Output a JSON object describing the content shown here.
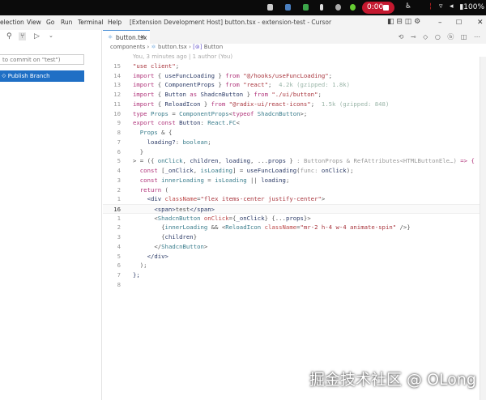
{
  "system_bar": {
    "recording_time": "0:00",
    "battery": "100%"
  },
  "menu": [
    "election",
    "View",
    "Go",
    "Run",
    "Terminal",
    "Help"
  ],
  "window_title": "[Extension Development Host] button.tsx - extension-test - Cursor",
  "sidebar": {
    "commit_placeholder": "to commit on \"test\")",
    "publish_label": "Publish Branch"
  },
  "tab": {
    "label": "button.tsx"
  },
  "breadcrumb": {
    "folder": "components",
    "file": "button.tsx",
    "symbol": "Button"
  },
  "blame": "You, 3 minutes ago | 1 author (You)",
  "code": [
    {
      "n": "15",
      "t": [
        [
          "\"use client\"",
          "s"
        ],
        [
          ";",
          "p"
        ]
      ]
    },
    {
      "n": "14",
      "t": [
        [
          "import",
          "k"
        ],
        [
          " { ",
          "p"
        ],
        [
          "useFuncLoading",
          "i"
        ],
        [
          " } ",
          "p"
        ],
        [
          "from",
          "k"
        ],
        [
          " \"@/hooks/useFuncLoading\"",
          "s"
        ],
        [
          ";",
          "p"
        ]
      ]
    },
    {
      "n": "13",
      "t": [
        [
          "import",
          "k"
        ],
        [
          " { ",
          "p"
        ],
        [
          "ComponentProps",
          "i"
        ],
        [
          " } ",
          "p"
        ],
        [
          "from",
          "k"
        ],
        [
          " \"react\"",
          "s"
        ],
        [
          ";  ",
          "p"
        ],
        [
          "4.2k (gzipped: 1.8k)",
          "h"
        ]
      ]
    },
    {
      "n": "12",
      "t": [
        [
          "import",
          "k"
        ],
        [
          " { ",
          "p"
        ],
        [
          "Button",
          "i"
        ],
        [
          " as ",
          "k"
        ],
        [
          "ShadcnButton",
          "i"
        ],
        [
          " } ",
          "p"
        ],
        [
          "from",
          "k"
        ],
        [
          " \"./ui/button\"",
          "s"
        ],
        [
          ";",
          "p"
        ]
      ]
    },
    {
      "n": "11",
      "t": [
        [
          "import",
          "k"
        ],
        [
          " { ",
          "p"
        ],
        [
          "ReloadIcon",
          "i"
        ],
        [
          " } ",
          "p"
        ],
        [
          "from",
          "k"
        ],
        [
          " \"@radix-ui/react-icons\"",
          "s"
        ],
        [
          ";  ",
          "p"
        ],
        [
          "1.5k (gzipped: 848)",
          "h"
        ]
      ]
    },
    {
      "n": "10",
      "t": [
        [
          "type",
          "k"
        ],
        [
          " Props",
          "t"
        ],
        [
          " = ",
          "p"
        ],
        [
          "ComponentProps",
          "t"
        ],
        [
          "<",
          "p"
        ],
        [
          "typeof",
          "k"
        ],
        [
          " ShadcnButton",
          "t"
        ],
        [
          ">;",
          "p"
        ]
      ]
    },
    {
      "n": "9",
      "t": [
        [
          "export const",
          "k"
        ],
        [
          " Button",
          "i"
        ],
        [
          ": ",
          "p"
        ],
        [
          "React",
          "t"
        ],
        [
          ".",
          "p"
        ],
        [
          "FC",
          "t"
        ],
        [
          "<",
          "p"
        ]
      ]
    },
    {
      "n": "8",
      "t": [
        [
          "  Props",
          "t"
        ],
        [
          " & {",
          "p"
        ]
      ]
    },
    {
      "n": "7",
      "t": [
        [
          "    loading?",
          "i"
        ],
        [
          ": ",
          "p"
        ],
        [
          "boolean",
          "t"
        ],
        [
          ";",
          "p"
        ]
      ]
    },
    {
      "n": "6",
      "t": [
        [
          "  }",
          "p"
        ]
      ]
    },
    {
      "n": "5",
      "t": [
        [
          "> = ({ ",
          "p"
        ],
        [
          "onClick",
          "t"
        ],
        [
          ", ",
          "p"
        ],
        [
          "children",
          "i"
        ],
        [
          ", ",
          "p"
        ],
        [
          "loading",
          "i"
        ],
        [
          ", ...",
          "p"
        ],
        [
          "props",
          "i"
        ],
        [
          " } ",
          "p"
        ],
        [
          ": ButtonProps & RefAttributes<HTMLButtonEle…)",
          "g"
        ],
        [
          " => {",
          "k"
        ]
      ]
    },
    {
      "n": "4",
      "t": [
        [
          "  const",
          "k"
        ],
        [
          " [",
          "p"
        ],
        [
          "_onClick",
          "i"
        ],
        [
          ", ",
          "p"
        ],
        [
          "isLoading",
          "t"
        ],
        [
          "] = ",
          "p"
        ],
        [
          "useFuncLoading",
          "i"
        ],
        [
          "(",
          "p"
        ],
        [
          "func:",
          "g"
        ],
        [
          " onClick",
          "i"
        ],
        [
          ");",
          "p"
        ]
      ]
    },
    {
      "n": "3",
      "t": [
        [
          "  const",
          "k"
        ],
        [
          " innerLoading",
          "t"
        ],
        [
          " = ",
          "p"
        ],
        [
          "isLoading",
          "t"
        ],
        [
          " || ",
          "p"
        ],
        [
          "loading",
          "i"
        ],
        [
          ";",
          "p"
        ]
      ]
    },
    {
      "n": "2",
      "t": [
        [
          "  return",
          "k"
        ],
        [
          " (",
          "p"
        ]
      ]
    },
    {
      "n": "1",
      "t": [
        [
          "    <div ",
          "i"
        ],
        [
          "className",
          "a"
        ],
        [
          "=",
          "p"
        ],
        [
          "\"flex items-center justify-center\"",
          "s"
        ],
        [
          ">",
          "p"
        ]
      ]
    },
    {
      "n": "16",
      "cur": true,
      "t": [
        [
          "      <span>",
          "i"
        ],
        [
          "test",
          "p"
        ],
        [
          "</span>",
          "i"
        ]
      ]
    },
    {
      "n": "1",
      "t": [
        [
          "      <",
          "p"
        ],
        [
          "ShadcnButton",
          "t"
        ],
        [
          " onClick",
          "a"
        ],
        [
          "={",
          "p"
        ],
        [
          "_onClick",
          "i"
        ],
        [
          "} {...",
          "p"
        ],
        [
          "props",
          "i"
        ],
        [
          "}>",
          "p"
        ]
      ]
    },
    {
      "n": "2",
      "t": [
        [
          "        {",
          "p"
        ],
        [
          "innerLoading",
          "t"
        ],
        [
          " && <",
          "p"
        ],
        [
          "ReloadIcon",
          "t"
        ],
        [
          " className",
          "a"
        ],
        [
          "=",
          "p"
        ],
        [
          "\"mr-2 h-4 w-4 animate-spin\"",
          "s"
        ],
        [
          " />}",
          "p"
        ]
      ]
    },
    {
      "n": "3",
      "t": [
        [
          "        {",
          "p"
        ],
        [
          "children",
          "i"
        ],
        [
          "}",
          "p"
        ]
      ]
    },
    {
      "n": "4",
      "t": [
        [
          "      </",
          "p"
        ],
        [
          "ShadcnButton",
          "t"
        ],
        [
          ">",
          "p"
        ]
      ]
    },
    {
      "n": "5",
      "t": [
        [
          "    </div>",
          "i"
        ]
      ]
    },
    {
      "n": "6",
      "t": [
        [
          "  );",
          "p"
        ]
      ]
    },
    {
      "n": "7",
      "t": [
        [
          "};",
          "i"
        ]
      ]
    },
    {
      "n": "8",
      "t": []
    }
  ],
  "watermark": "掘金技术社区 @ OLong"
}
